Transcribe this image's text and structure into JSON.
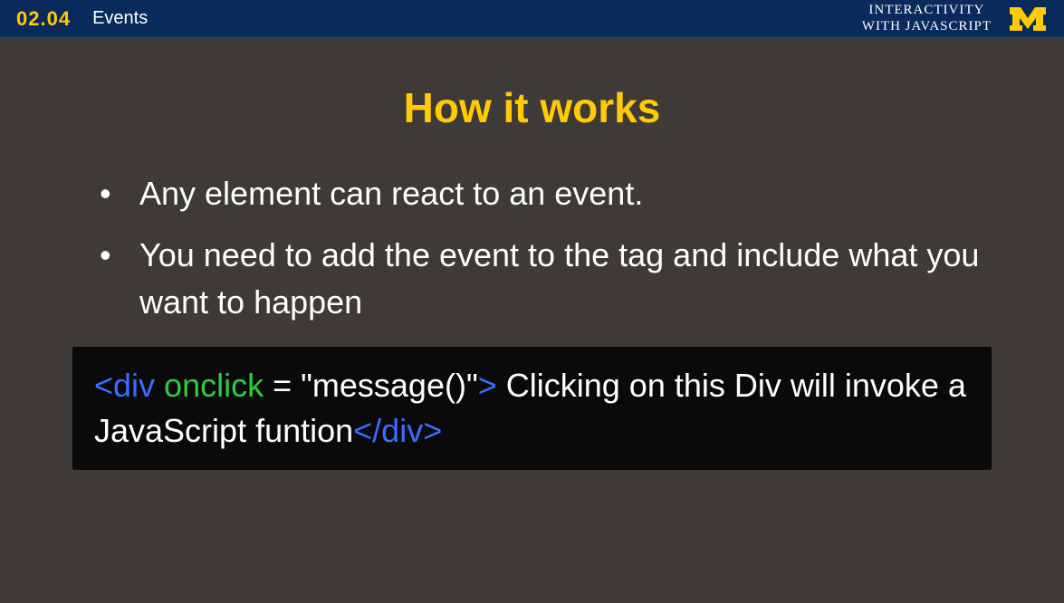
{
  "header": {
    "lesson_number": "02.04",
    "lesson_title": "Events",
    "course_line1": "INTERACTIVITY",
    "course_line2": "WITH JAVASCRIPT"
  },
  "slide": {
    "title": "How it works",
    "bullet1": "Any element can react to an event.",
    "bullet2": "You need to add the event to the tag and include what you want to happen"
  },
  "code": {
    "open_tag": "<div",
    "attr": " onclick",
    "eq": " = ",
    "str": "\"message()\"",
    "close_open": ">",
    "body": " Clicking on this Div will invoke a JavaScript funtion",
    "close_tag": "</div>"
  }
}
